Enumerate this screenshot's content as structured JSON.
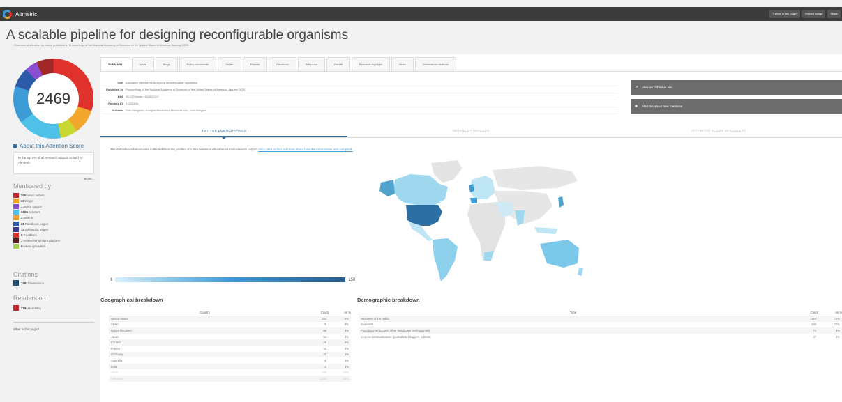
{
  "app": {
    "name": "Altmetric",
    "buttons": [
      "? What is this page?",
      "Embed badge",
      "Share"
    ]
  },
  "article": {
    "title": "A scalable pipeline for designing reconfigurable organisms",
    "subtitle": "Overview of attention for article published in Proceedings of the National Academy of Sciences of the United States of America, January 2020"
  },
  "score": "2469",
  "about": {
    "heading": "About this Attention Score",
    "text": "In the top 5% of all research outputs scored by Altmetric",
    "more": "MORE..."
  },
  "mentioned": {
    "heading": "Mentioned by",
    "items": [
      {
        "count": "200",
        "label": "news outlets",
        "color": "#c1272d"
      },
      {
        "count": "33",
        "label": "blogs",
        "color": "#f2a72c"
      },
      {
        "count": "1",
        "label": "policy source",
        "color": "#8a4fd1"
      },
      {
        "count": "1655",
        "label": "tweeters",
        "color": "#4fc1e9"
      },
      {
        "count": "2",
        "label": "patents",
        "color": "#f0a230"
      },
      {
        "count": "28",
        "label": "Facebook pages",
        "color": "#2a5aa8"
      },
      {
        "count": "14",
        "label": "Wikipedia pages",
        "color": "#3b3b8f"
      },
      {
        "count": "9",
        "label": "Redditors",
        "color": "#e0322c"
      },
      {
        "count": "1",
        "label": "research highlight platform",
        "color": "#5a1e1e"
      },
      {
        "count": "9",
        "label": "video uploaders",
        "color": "#a4cf52"
      }
    ]
  },
  "citations": {
    "heading": "Citations",
    "count": "158",
    "label": "Dimensions",
    "color": "#1f4e6e"
  },
  "readers": {
    "heading": "Readers on",
    "count": "719",
    "label": "Mendeley",
    "color": "#c1272d"
  },
  "what_link": "What is this page?",
  "tabs": [
    "SUMMARY",
    "News",
    "Blogs",
    "Policy documents",
    "Twitter",
    "Patents",
    "Facebook",
    "Wikipedia",
    "Reddit",
    "Research highlight",
    "Video",
    "Dimensions citations"
  ],
  "details": [
    {
      "label": "Title",
      "value": "A scalable pipeline for designing reconfigurable organisms"
    },
    {
      "label": "Published in",
      "value": "Proceedings of the National Academy of Sciences of the United States of America, January 2020"
    },
    {
      "label": "DOI",
      "value": "10.1073/pnas.1910837117"
    },
    {
      "label": "Pubmed ID",
      "value": "31932426"
    },
    {
      "label": "Authors",
      "value": "Sam Kriegman, Douglas Blackiston, Michael Levin, Josh Bongard"
    }
  ],
  "side_buttons": [
    "View on publisher site",
    "Alert me about new mentions"
  ],
  "subtabs": [
    "TWITTER DEMOGRAPHICS",
    "MENDELEY READERS",
    "ATTENTION SCORE IN CONTEXT"
  ],
  "intro": {
    "text": "The data shown below were collected from the profiles of 1,655 tweeters who shared this research output.",
    "link": "Click here to find out more about how the information was compiled."
  },
  "legend": {
    "min": "1",
    "max": "150"
  },
  "geo": {
    "heading": "Geographical breakdown",
    "columns": [
      "Country",
      "Count",
      "As %"
    ],
    "rows": [
      {
        "name": "United States",
        "count": "150",
        "pct": "9%"
      },
      {
        "name": "Spain",
        "count": "75",
        "pct": "5%"
      },
      {
        "name": "United Kingdom",
        "count": "65",
        "pct": "4%"
      },
      {
        "name": "Japan",
        "count": "51",
        "pct": "3%"
      },
      {
        "name": "Canada",
        "count": "29",
        "pct": "2%"
      },
      {
        "name": "France",
        "count": "25",
        "pct": "2%"
      },
      {
        "name": "Germany",
        "count": "21",
        "pct": "1%"
      },
      {
        "name": "Australia",
        "count": "16",
        "pct": "1%"
      },
      {
        "name": "India",
        "count": "13",
        "pct": "1%"
      },
      {
        "name": "Other",
        "count": "160",
        "pct": "10%"
      },
      {
        "name": "Unknown",
        "count": "1050",
        "pct": "63%"
      }
    ]
  },
  "demo": {
    "heading": "Demographic breakdown",
    "columns": [
      "Type",
      "Count",
      "As %"
    ],
    "rows": [
      {
        "name": "Members of the public",
        "count": "1199",
        "pct": "72%"
      },
      {
        "name": "Scientists",
        "count": "188",
        "pct": "11%"
      },
      {
        "name": "Practitioners (doctors, other healthcare professionals)",
        "count": "73",
        "pct": "4%"
      },
      {
        "name": "Science communicators (journalists, bloggers, editors)",
        "count": "37",
        "pct": "2%"
      }
    ]
  }
}
